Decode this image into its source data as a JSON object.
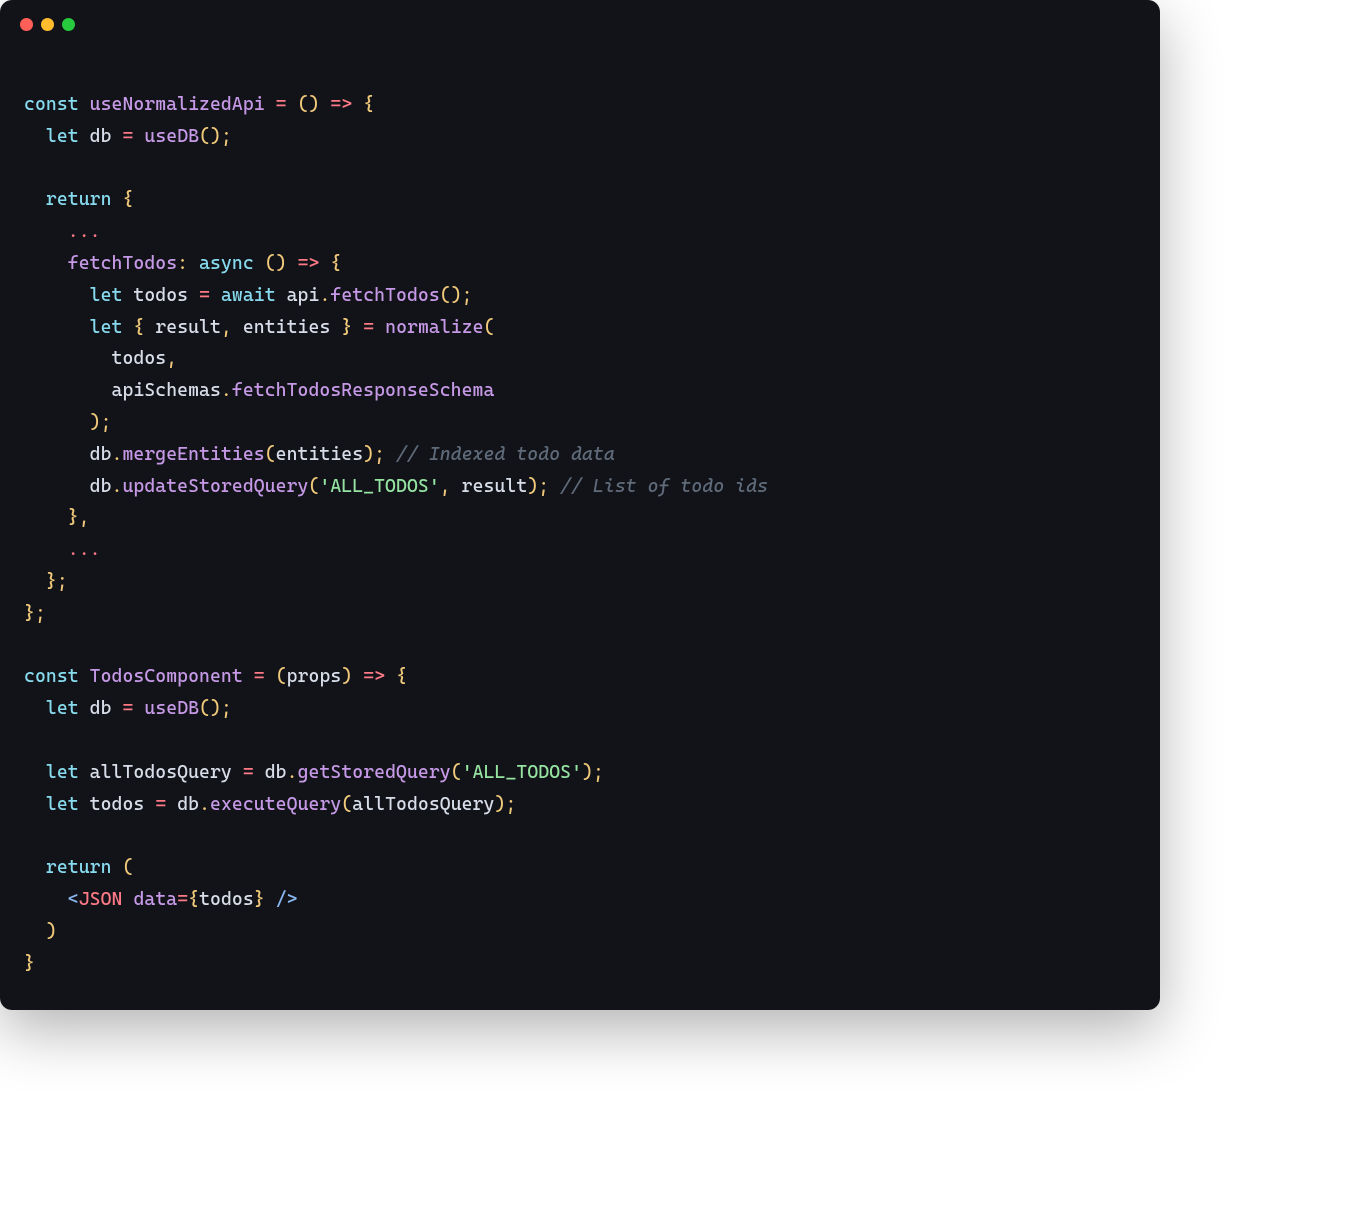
{
  "window": {
    "traffic_lights": [
      "red",
      "yellow",
      "green"
    ]
  },
  "colors": {
    "bg": "#121319",
    "keyword": "#87dbee",
    "function": "#c699e6",
    "identifier": "#d8dee9",
    "operator": "#ff7a87",
    "punctuation": "#f0c97a",
    "string": "#95e3a1",
    "comment": "#5f6b7a",
    "jsx_tag": "#ff7a87",
    "jsx_attr": "#c699e6",
    "jsx_delim": "#8bb8f0"
  },
  "code": {
    "lines": [
      [],
      [
        {
          "t": "kw",
          "v": "const"
        },
        {
          "t": "id",
          "v": " "
        },
        {
          "t": "fn",
          "v": "useNormalizedApi"
        },
        {
          "t": "id",
          "v": " "
        },
        {
          "t": "op",
          "v": "="
        },
        {
          "t": "id",
          "v": " "
        },
        {
          "t": "pn",
          "v": "()"
        },
        {
          "t": "id",
          "v": " "
        },
        {
          "t": "op",
          "v": "=>"
        },
        {
          "t": "id",
          "v": " "
        },
        {
          "t": "pn",
          "v": "{"
        }
      ],
      [
        {
          "t": "id",
          "v": "  "
        },
        {
          "t": "kw",
          "v": "let"
        },
        {
          "t": "id",
          "v": " db "
        },
        {
          "t": "op",
          "v": "="
        },
        {
          "t": "id",
          "v": " "
        },
        {
          "t": "fn",
          "v": "useDB"
        },
        {
          "t": "pn",
          "v": "();"
        }
      ],
      [],
      [
        {
          "t": "id",
          "v": "  "
        },
        {
          "t": "kw",
          "v": "return"
        },
        {
          "t": "id",
          "v": " "
        },
        {
          "t": "pn",
          "v": "{"
        }
      ],
      [
        {
          "t": "id",
          "v": "    "
        },
        {
          "t": "op",
          "v": "..."
        }
      ],
      [
        {
          "t": "id",
          "v": "    "
        },
        {
          "t": "fn",
          "v": "fetchTodos"
        },
        {
          "t": "pn",
          "v": ":"
        },
        {
          "t": "id",
          "v": " "
        },
        {
          "t": "kw",
          "v": "async"
        },
        {
          "t": "id",
          "v": " "
        },
        {
          "t": "pn",
          "v": "()"
        },
        {
          "t": "id",
          "v": " "
        },
        {
          "t": "op",
          "v": "=>"
        },
        {
          "t": "id",
          "v": " "
        },
        {
          "t": "pn",
          "v": "{"
        }
      ],
      [
        {
          "t": "id",
          "v": "      "
        },
        {
          "t": "kw",
          "v": "let"
        },
        {
          "t": "id",
          "v": " todos "
        },
        {
          "t": "op",
          "v": "="
        },
        {
          "t": "id",
          "v": " "
        },
        {
          "t": "kw",
          "v": "await"
        },
        {
          "t": "id",
          "v": " api"
        },
        {
          "t": "pn",
          "v": "."
        },
        {
          "t": "fn",
          "v": "fetchTodos"
        },
        {
          "t": "pn",
          "v": "();"
        }
      ],
      [
        {
          "t": "id",
          "v": "      "
        },
        {
          "t": "kw",
          "v": "let"
        },
        {
          "t": "id",
          "v": " "
        },
        {
          "t": "pn",
          "v": "{"
        },
        {
          "t": "id",
          "v": " result"
        },
        {
          "t": "pn",
          "v": ","
        },
        {
          "t": "id",
          "v": " entities "
        },
        {
          "t": "pn",
          "v": "}"
        },
        {
          "t": "id",
          "v": " "
        },
        {
          "t": "op",
          "v": "="
        },
        {
          "t": "id",
          "v": " "
        },
        {
          "t": "fn",
          "v": "normalize"
        },
        {
          "t": "pn",
          "v": "("
        }
      ],
      [
        {
          "t": "id",
          "v": "        todos"
        },
        {
          "t": "pn",
          "v": ","
        }
      ],
      [
        {
          "t": "id",
          "v": "        apiSchemas"
        },
        {
          "t": "pn",
          "v": "."
        },
        {
          "t": "fn",
          "v": "fetchTodosResponseSchema"
        }
      ],
      [
        {
          "t": "id",
          "v": "      "
        },
        {
          "t": "pn",
          "v": ");"
        }
      ],
      [
        {
          "t": "id",
          "v": "      db"
        },
        {
          "t": "pn",
          "v": "."
        },
        {
          "t": "fn",
          "v": "mergeEntities"
        },
        {
          "t": "pn",
          "v": "("
        },
        {
          "t": "id",
          "v": "entities"
        },
        {
          "t": "pn",
          "v": ");"
        },
        {
          "t": "id",
          "v": " "
        },
        {
          "t": "cmt",
          "v": "// Indexed todo data"
        }
      ],
      [
        {
          "t": "id",
          "v": "      db"
        },
        {
          "t": "pn",
          "v": "."
        },
        {
          "t": "fn",
          "v": "updateStoredQuery"
        },
        {
          "t": "pn",
          "v": "("
        },
        {
          "t": "str",
          "v": "'ALL_TODOS'"
        },
        {
          "t": "pn",
          "v": ","
        },
        {
          "t": "id",
          "v": " result"
        },
        {
          "t": "pn",
          "v": ");"
        },
        {
          "t": "id",
          "v": " "
        },
        {
          "t": "cmt",
          "v": "// List of todo ids"
        }
      ],
      [
        {
          "t": "id",
          "v": "    "
        },
        {
          "t": "pn",
          "v": "},"
        }
      ],
      [
        {
          "t": "id",
          "v": "    "
        },
        {
          "t": "op",
          "v": "..."
        }
      ],
      [
        {
          "t": "id",
          "v": "  "
        },
        {
          "t": "pn",
          "v": "};"
        }
      ],
      [
        {
          "t": "pn",
          "v": "};"
        }
      ],
      [],
      [
        {
          "t": "kw",
          "v": "const"
        },
        {
          "t": "id",
          "v": " "
        },
        {
          "t": "fn",
          "v": "TodosComponent"
        },
        {
          "t": "id",
          "v": " "
        },
        {
          "t": "op",
          "v": "="
        },
        {
          "t": "id",
          "v": " "
        },
        {
          "t": "pn",
          "v": "("
        },
        {
          "t": "id",
          "v": "props"
        },
        {
          "t": "pn",
          "v": ")"
        },
        {
          "t": "id",
          "v": " "
        },
        {
          "t": "op",
          "v": "=>"
        },
        {
          "t": "id",
          "v": " "
        },
        {
          "t": "pn",
          "v": "{"
        }
      ],
      [
        {
          "t": "id",
          "v": "  "
        },
        {
          "t": "kw",
          "v": "let"
        },
        {
          "t": "id",
          "v": " db "
        },
        {
          "t": "op",
          "v": "="
        },
        {
          "t": "id",
          "v": " "
        },
        {
          "t": "fn",
          "v": "useDB"
        },
        {
          "t": "pn",
          "v": "();"
        }
      ],
      [],
      [
        {
          "t": "id",
          "v": "  "
        },
        {
          "t": "kw",
          "v": "let"
        },
        {
          "t": "id",
          "v": " allTodosQuery "
        },
        {
          "t": "op",
          "v": "="
        },
        {
          "t": "id",
          "v": " db"
        },
        {
          "t": "pn",
          "v": "."
        },
        {
          "t": "fn",
          "v": "getStoredQuery"
        },
        {
          "t": "pn",
          "v": "("
        },
        {
          "t": "str",
          "v": "'ALL_TODOS'"
        },
        {
          "t": "pn",
          "v": ");"
        }
      ],
      [
        {
          "t": "id",
          "v": "  "
        },
        {
          "t": "kw",
          "v": "let"
        },
        {
          "t": "id",
          "v": " todos "
        },
        {
          "t": "op",
          "v": "="
        },
        {
          "t": "id",
          "v": " db"
        },
        {
          "t": "pn",
          "v": "."
        },
        {
          "t": "fn",
          "v": "executeQuery"
        },
        {
          "t": "pn",
          "v": "("
        },
        {
          "t": "id",
          "v": "allTodosQuery"
        },
        {
          "t": "pn",
          "v": ");"
        }
      ],
      [],
      [
        {
          "t": "id",
          "v": "  "
        },
        {
          "t": "kw",
          "v": "return"
        },
        {
          "t": "id",
          "v": " "
        },
        {
          "t": "pn",
          "v": "("
        }
      ],
      [
        {
          "t": "id",
          "v": "    "
        },
        {
          "t": "lt",
          "v": "<"
        },
        {
          "t": "tag",
          "v": "JSON"
        },
        {
          "t": "id",
          "v": " "
        },
        {
          "t": "attr",
          "v": "data"
        },
        {
          "t": "op",
          "v": "="
        },
        {
          "t": "pn",
          "v": "{"
        },
        {
          "t": "id",
          "v": "todos"
        },
        {
          "t": "pn",
          "v": "}"
        },
        {
          "t": "id",
          "v": " "
        },
        {
          "t": "lt",
          "v": "/>"
        }
      ],
      [
        {
          "t": "id",
          "v": "  "
        },
        {
          "t": "pn",
          "v": ")"
        }
      ],
      [
        {
          "t": "pn",
          "v": "}"
        }
      ]
    ]
  }
}
